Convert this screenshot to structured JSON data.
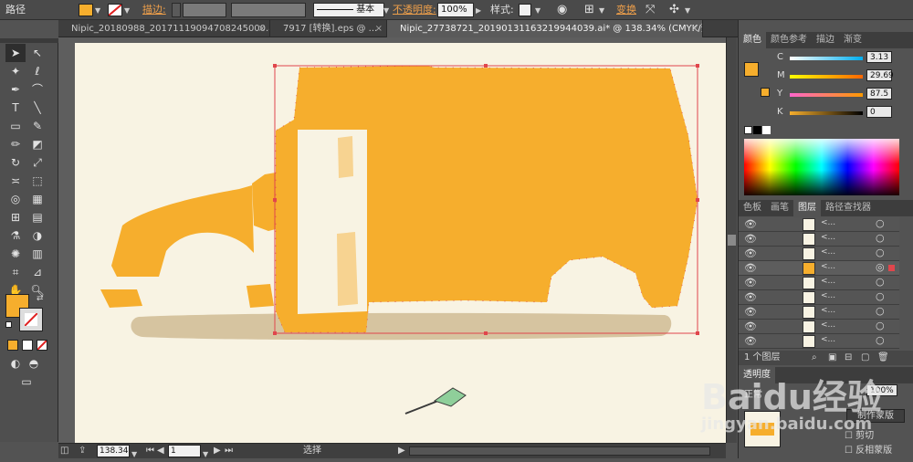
{
  "control_bar": {
    "object_type": "路径",
    "stroke_label": "描边:",
    "stroke_style": "基本",
    "opacity_label": "不透明度:",
    "opacity_value": "100%",
    "style_label": "样式:",
    "transform_label": "变换"
  },
  "tabs": [
    {
      "label": "Nipic_20180988_20171119094708245000.ai* ..."
    },
    {
      "label": "7917 [转换].eps @ ..."
    },
    {
      "label": "Nipic_27738721_20190131163219944039.ai* @ 138.34% (CMYK/预览)"
    }
  ],
  "color_panel": {
    "tabs": [
      "颜色",
      "颜色参考",
      "描边",
      "渐变"
    ],
    "channels": [
      {
        "name": "C",
        "value": "3.13"
      },
      {
        "name": "M",
        "value": "29.69"
      },
      {
        "name": "Y",
        "value": "87.5"
      },
      {
        "name": "K",
        "value": "0"
      }
    ],
    "fill_color": "#f6ae2d"
  },
  "layers_panel": {
    "tabs": [
      "色板",
      "画笔",
      "图层",
      "路径查找器"
    ],
    "row_label": "<...",
    "count_label": "1 个图层"
  },
  "transparency_panel": {
    "tab": "透明度",
    "mode": "正常",
    "opacity": "100%",
    "make_mask": "制作蒙版",
    "clip": "剪切",
    "invert_mask": "反相蒙版"
  },
  "status": {
    "zoom": "138.34",
    "page": "1",
    "tool_name": "选择"
  },
  "watermark": {
    "brand": "Baidu经验",
    "url": "jingyan.baidu.com"
  },
  "colors": {
    "truck": "#f6ae2d",
    "shadow": "#d6c4a0",
    "artboard": "#f8f3e3",
    "selection": "#e0464c",
    "ui_bg": "#535353"
  }
}
